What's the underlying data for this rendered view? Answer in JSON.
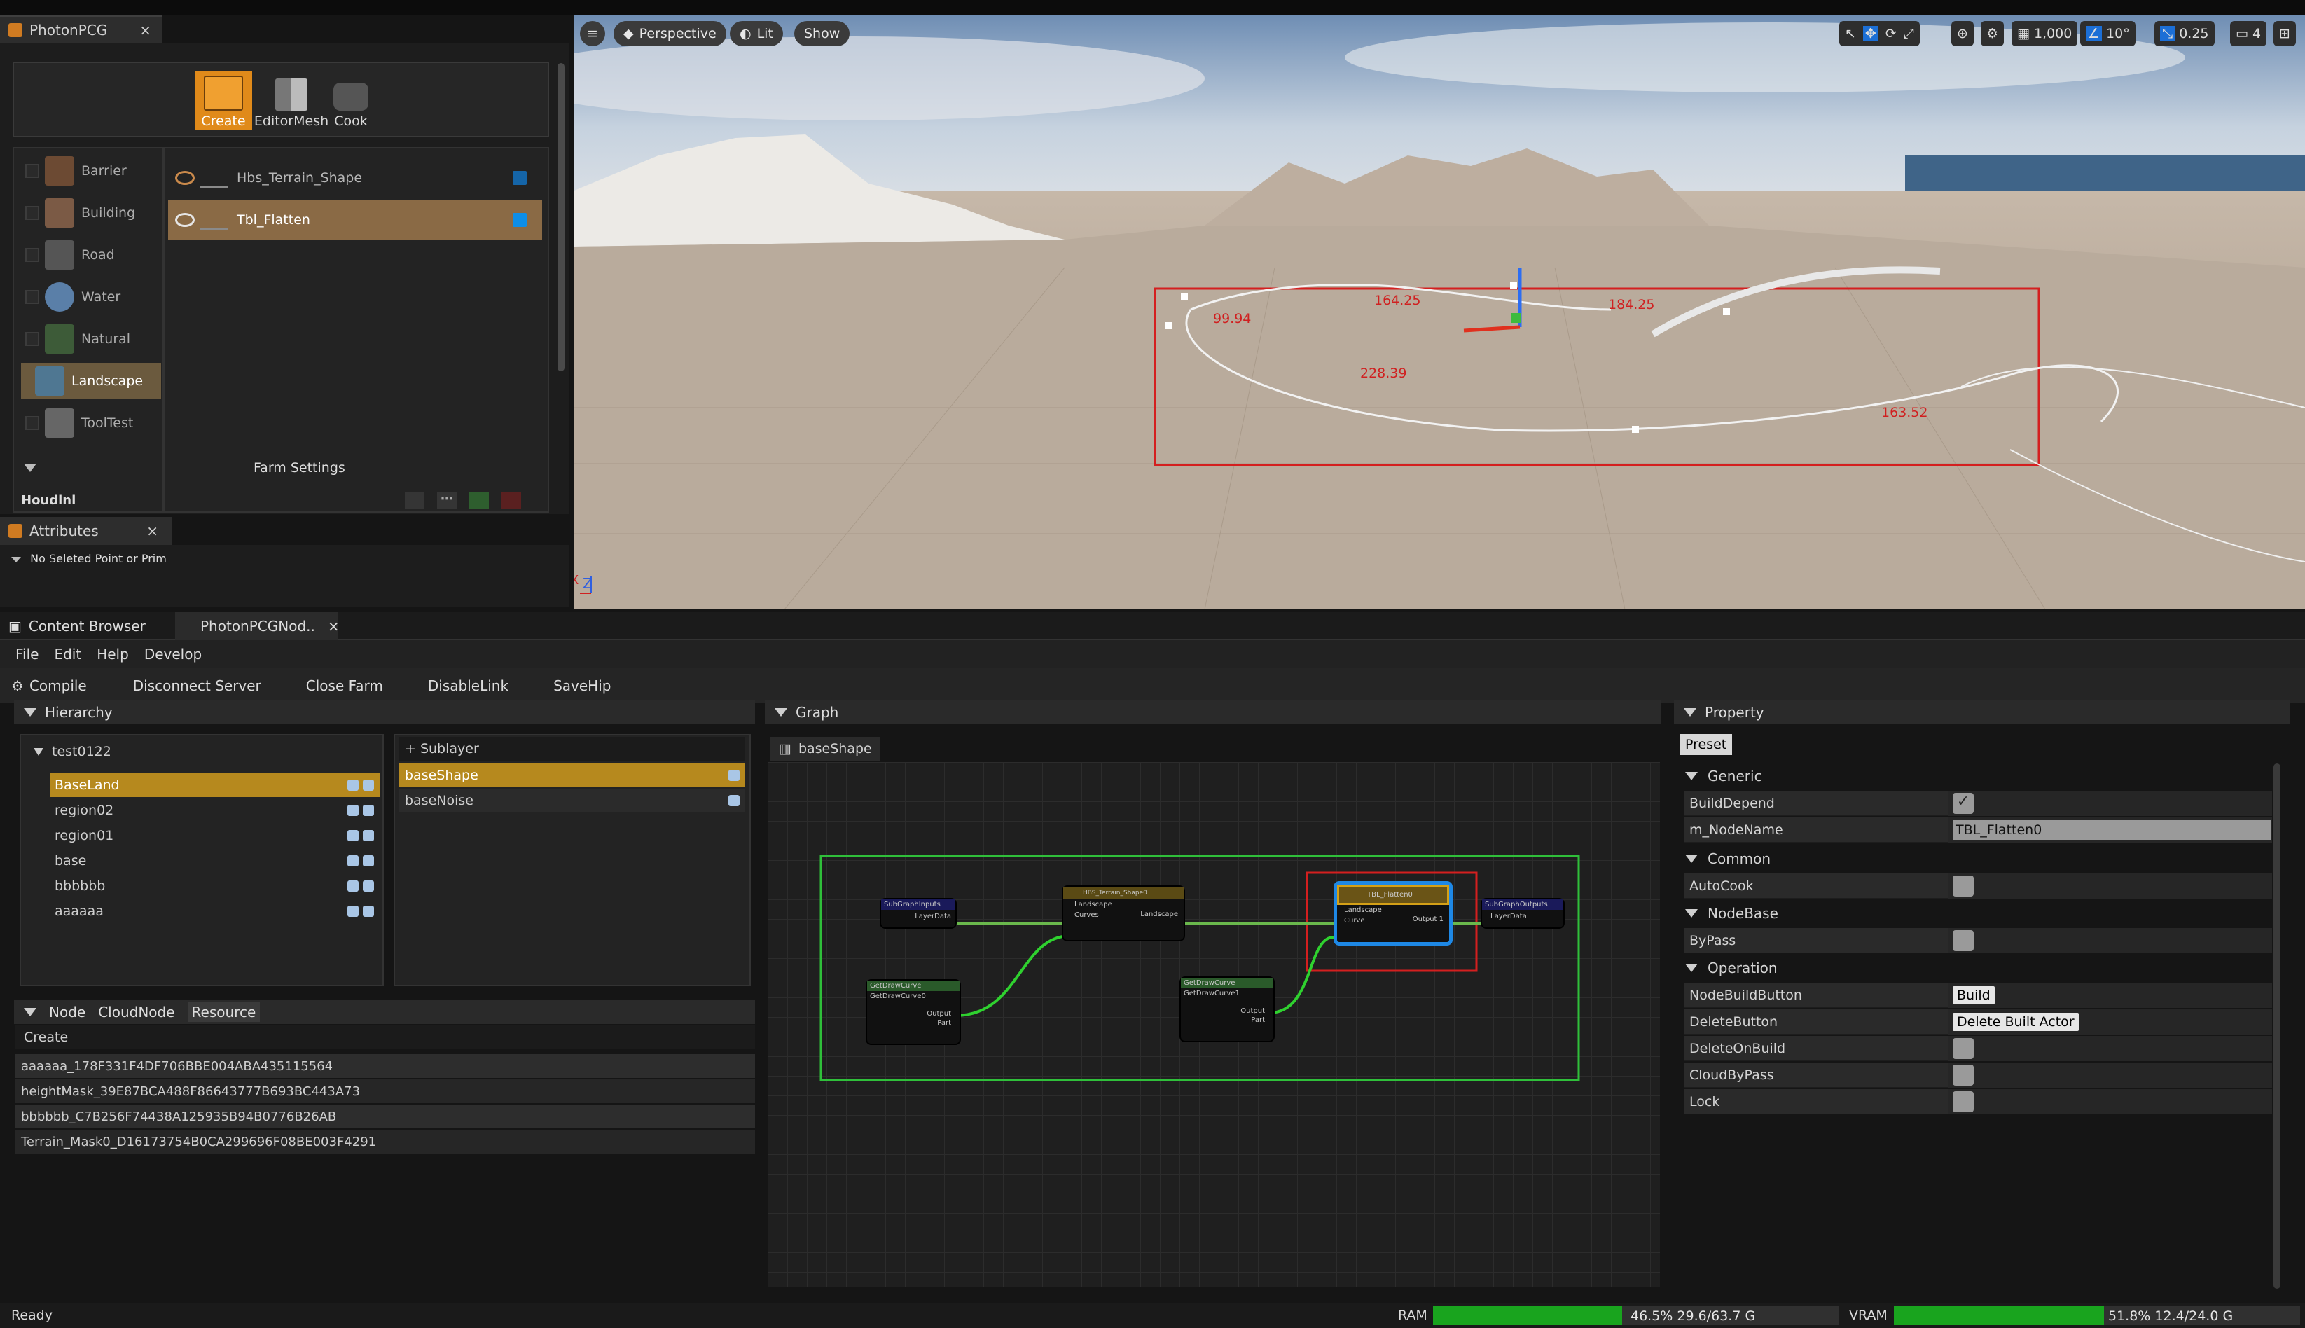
{
  "photonpcg_tab": {
    "title": "PhotonPCG",
    "close": "×"
  },
  "tools": [
    {
      "label": "Create",
      "icon": "create-tool-icon"
    },
    {
      "label": "EditorMesh",
      "icon": "editormesh-icon"
    },
    {
      "label": "Cook",
      "icon": "cook-icon"
    }
  ],
  "categories": [
    "Barrier",
    "Building",
    "Road",
    "Water",
    "Natural",
    "Landscape",
    "ToolTest"
  ],
  "selected_category": "Landscape",
  "shapes": [
    "Hbs_Terrain_Shape",
    "Tbl_Flatten"
  ],
  "farm_settings": "Farm Settings",
  "houdini_label": "Houdini",
  "attributes_tab": {
    "title": "Attributes",
    "close": "×"
  },
  "attributes_status": "No Seleted Point or Prim",
  "viewport": {
    "perspective": "Perspective",
    "lit": "Lit",
    "show": "Show",
    "grid_snap": "1,000",
    "angle_snap": "10°",
    "scale_snap": "0.25",
    "camera_speed": "4",
    "measurements": [
      "164.25",
      "99.94",
      "184.25",
      "228.39",
      "163.52"
    ]
  },
  "bottom_tabs": {
    "content_browser": "Content Browser",
    "node_editor": "PhotonPCGNod..",
    "close": "×"
  },
  "menu": [
    "File",
    "Edit",
    "Help",
    "Develop"
  ],
  "toolbar": [
    "Compile",
    "Disconnect Server",
    "Close Farm",
    "DisableLink",
    "SaveHip"
  ],
  "hierarchy": {
    "title": "Hierarchy",
    "root": "test0122",
    "items": [
      "BaseLand",
      "region02",
      "region01",
      "base",
      "bbbbbb",
      "aaaaaa"
    ],
    "selected": "BaseLand"
  },
  "sublayer": {
    "add": "+ Sublayer",
    "items": [
      "baseShape",
      "baseNoise"
    ],
    "selected": "baseShape"
  },
  "node_tabs": [
    "Node",
    "CloudNode",
    "Resource"
  ],
  "resource_create": "Create",
  "resources": [
    "aaaaaa_178F331F4DF706BBE004ABA435115564",
    "heightMask_39E87BCA488F86643777B693BC443A73",
    "bbbbbb_C7B256F74438A125935B94B0776B26AB",
    "Terrain_Mask0_D16173754B0CA299696F08BE003F4291"
  ],
  "graph": {
    "title": "Graph",
    "tab": "baseShape",
    "nodes": {
      "input": {
        "title": "SubGraphInputs",
        "port": "LayerData"
      },
      "terrain": {
        "title": "HBS_Terrain_Shape0",
        "in1": "Landscape",
        "in2": "Curves",
        "out": "Landscape"
      },
      "flatten": {
        "title": "TBL_Flatten0",
        "in1": "Landscape",
        "in2": "Curve",
        "out": "Output 1"
      },
      "output": {
        "title": "SubGraphOutputs",
        "port": "LayerData"
      },
      "curve1": {
        "title": "GetDrawCurve",
        "name": "GetDrawCurve0",
        "out1": "Output",
        "out2": "Part"
      },
      "curve2": {
        "title": "GetDrawCurve",
        "name": "GetDrawCurve1",
        "out1": "Output",
        "out2": "Part"
      }
    }
  },
  "property": {
    "title": "Property",
    "preset": "Preset",
    "sections": {
      "generic": "Generic",
      "common": "Common",
      "nodebase": "NodeBase",
      "operation": "Operation"
    },
    "build_depend": "BuildDepend",
    "node_name_label": "m_NodeName",
    "node_name_value": "TBL_Flatten0",
    "autocook": "AutoCook",
    "bypass": "ByPass",
    "node_build_button": "NodeBuildButton",
    "build": "Build",
    "delete_button": "DeleteButton",
    "delete_built_actor": "Delete Built Actor",
    "delete_on_build": "DeleteOnBuild",
    "cloud_bypass": "CloudByPass",
    "lock": "Lock"
  },
  "status": {
    "ready": "Ready",
    "ram_label": "RAM",
    "ram_text": "46.5% 29.6/63.7 G",
    "ram_fraction": 0.465,
    "vram_label": "VRAM",
    "vram_text": "51.8% 12.4/24.0 G",
    "vram_fraction": 0.518
  },
  "colors": {
    "accent": "#b6891e",
    "selection_box": "#d41f1f",
    "group_box": "#2fbf3a",
    "usage_bar": "#19a41e"
  }
}
